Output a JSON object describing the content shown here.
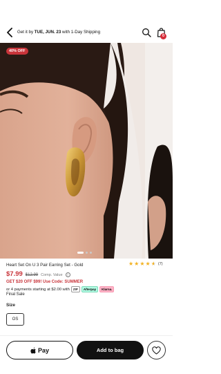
{
  "header": {
    "shipping_prefix": "Get it by ",
    "shipping_date": "TUE, JUN. 23",
    "shipping_suffix": " with 1-Day Shipping",
    "bag_count": "0"
  },
  "gallery": {
    "discount_badge": "40% OFF",
    "image_count": 3,
    "active_index": 0
  },
  "product": {
    "name": "Heart Set On U 3 Pair Earring Set - Gold",
    "rating": 4.5,
    "review_count": "(7)",
    "price": "$7.99",
    "original_price": "$12.99",
    "comp_value_label": "Comp. Value",
    "info_glyph": "i",
    "promo": "GET $20 OFF $99! Use Code: SUMMER",
    "payments_text": "or 4 payments starting at $2.00 with",
    "payment_providers": [
      "ZIP",
      "Afterpay",
      "Klarna."
    ],
    "final_sale": "Final Sale"
  },
  "size": {
    "label": "Size",
    "options": [
      "OS"
    ]
  },
  "actions": {
    "apple_pay_label": "Pay",
    "add_to_bag_label": "Add to bag"
  },
  "colors": {
    "accent_red": "#c8343a",
    "star": "#f2b01e",
    "afterpay": "#b2fce4",
    "klarna": "#ffb3c7"
  }
}
